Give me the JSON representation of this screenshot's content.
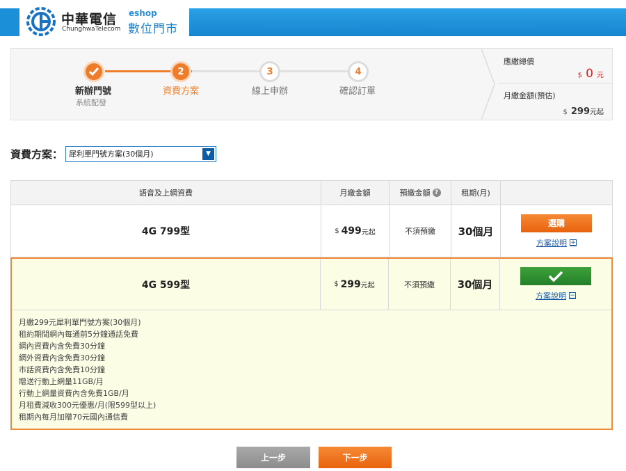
{
  "header": {
    "brand_zh": "中華電信",
    "brand_en": "ChunghwaTelecom",
    "eshop_tag": "eshop",
    "eshop_name": "數位門市",
    "colors": {
      "bar": "#1b8fd7"
    }
  },
  "steps": [
    {
      "number": "1",
      "label": "新辦門號",
      "sub": "系統配發",
      "state": "done"
    },
    {
      "number": "2",
      "label": "資費方案",
      "sub": "",
      "state": "current"
    },
    {
      "number": "3",
      "label": "線上申辦",
      "sub": "",
      "state": "todo"
    },
    {
      "number": "4",
      "label": "確認訂單",
      "sub": "",
      "state": "todo"
    }
  ],
  "summary": {
    "total_label": "應繳總價",
    "total_currency": "$",
    "total_value": "0",
    "total_unit": "元",
    "monthly_label": "月繳金額(預估)",
    "monthly_currency": "$",
    "monthly_value": "299",
    "monthly_unit": "元起"
  },
  "plan_select": {
    "label": "資費方案：",
    "selected": "犀利單門號方案(30個月)"
  },
  "table": {
    "headers": [
      "語音及上網資費",
      "月繳金額",
      "預繳金額",
      "租期(月)",
      ""
    ],
    "rows": [
      {
        "name": "4G 799型",
        "currency": "$",
        "price": "499",
        "price_unit": "元起",
        "prepay": "不須預繳",
        "period": "30個月",
        "action": "選購",
        "link": "方案說明",
        "link_toggle": "+",
        "selected": false
      },
      {
        "name": "4G 599型",
        "currency": "$",
        "price": "299",
        "price_unit": "元起",
        "prepay": "不須預繳",
        "period": "30個月",
        "action": "✔",
        "link": "方案說明",
        "link_toggle": "−",
        "selected": true
      }
    ],
    "details": [
      "月繳299元犀利單門號方案(30個月)",
      "租約期間網內每通前5分鐘通話免費",
      "網內資費內含免費30分鐘",
      "網外資費內含免費30分鐘",
      "市話資費內含免費10分鐘",
      "贈送行動上網量11GB/月",
      "行動上網量資費內含免費1GB/月",
      "月租費減收300元優惠/月(限599型以上)",
      "租期內每月加贈70元國內通信費"
    ]
  },
  "buttons": {
    "prev": "上一步",
    "next": "下一步"
  },
  "colors": {
    "accent": "#ee7d2b",
    "selected_green": "#2e8f2e",
    "highlight_bg": "#fcfde5",
    "price_red": "#e02020"
  }
}
